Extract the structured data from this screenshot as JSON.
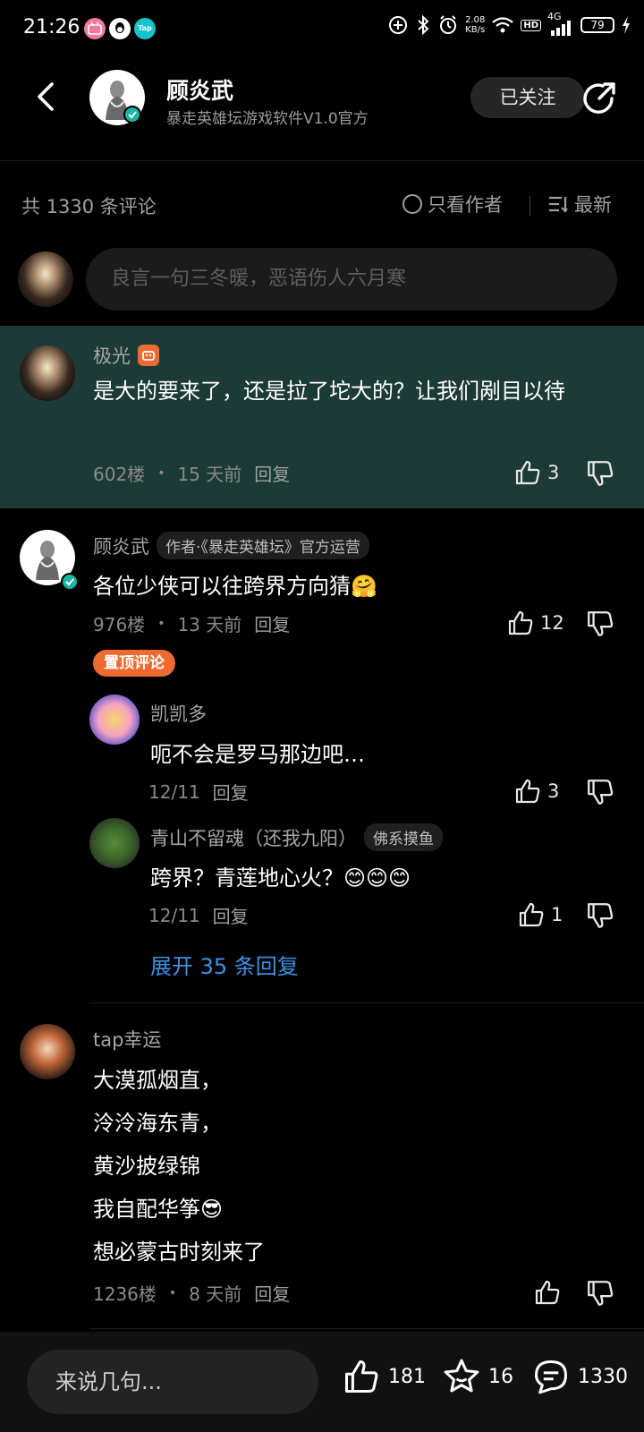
{
  "status_bar": {
    "time": "21:26",
    "net_speed": "2.08",
    "net_unit": "KB/s",
    "hd": "HD",
    "signal": "4G",
    "battery": "79",
    "apps": [
      "bili-icon",
      "qq-icon",
      "taptap-icon"
    ],
    "tap_label": "Tap"
  },
  "header": {
    "name": "顾炎武",
    "subtitle": "暴走英雄坛游戏软件V1.0官方",
    "follow_label": "已关注"
  },
  "sort": {
    "total": "共 1330 条评论",
    "author_only": "只看作者",
    "newest": "最新"
  },
  "input": {
    "placeholder": "良言一句三冬暖，恶语伤人六月寒"
  },
  "comments": [
    {
      "name": "极光",
      "text": "是大的要来了，还是拉了坨大的？让我们剐目以待",
      "floor": "602楼",
      "time": "15 天前",
      "reply": "回复",
      "likes": "3"
    },
    {
      "name": "顾炎武",
      "badge": "作者·《暴走英雄坛》官方运营",
      "text": "各位少侠可以往跨界方向猜🤗",
      "floor": "976楼",
      "time": "13 天前",
      "reply": "回复",
      "likes": "12",
      "pin": "置顶评论",
      "replies": [
        {
          "name": "凯凯多",
          "text": "呃不会是罗马那边吧…",
          "date": "12/11",
          "reply": "回复",
          "likes": "3"
        },
        {
          "name": "青山不留魂（还我九阳）",
          "badge": "佛系摸鱼",
          "text": "跨界？青莲地心火？😊😊😊",
          "date": "12/11",
          "reply": "回复",
          "likes": "1"
        }
      ],
      "expand": "展开 35 条回复"
    },
    {
      "name": "tap幸运",
      "lines": [
        "大漠孤烟直，",
        "泠泠海东青，",
        "黄沙披绿锦",
        "我自配华筝😎",
        "想必蒙古时刻来了"
      ],
      "floor": "1236楼",
      "time": "8 天前",
      "reply": "回复"
    }
  ],
  "bottom_bar": {
    "input_placeholder": "来说几句...",
    "likes": "181",
    "favorites": "16",
    "comments": "1330"
  },
  "colors": {
    "highlight_bg": "#1c3a36",
    "accent_blue": "#3d92e6",
    "pin_orange": "#ee6a30",
    "verify_teal": "#19b5a4"
  }
}
